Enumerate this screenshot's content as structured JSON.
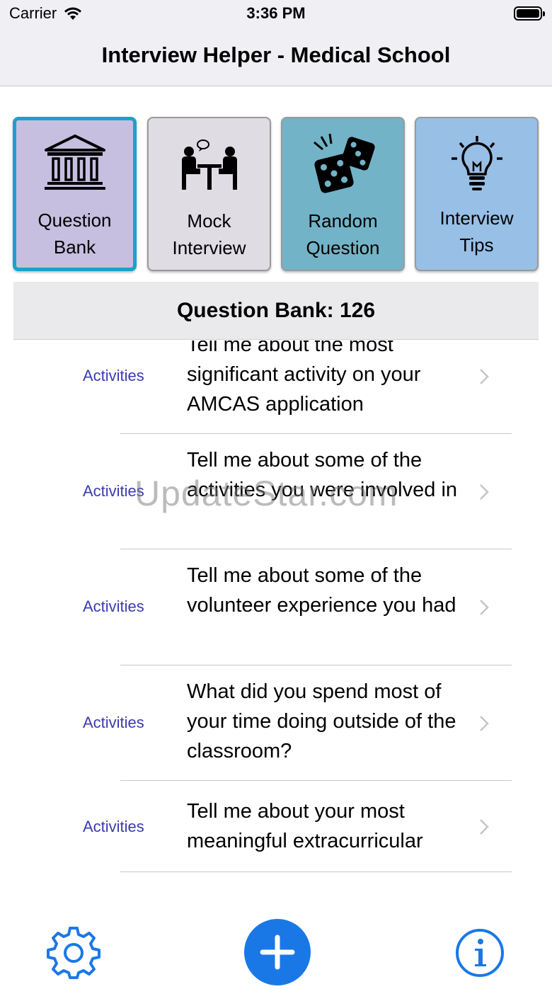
{
  "status": {
    "carrier": "Carrier",
    "time": "3:36 PM"
  },
  "nav": {
    "title": "Interview Helper - Medical School"
  },
  "tiles": [
    {
      "label_line1": "Question",
      "label_line2": "Bank",
      "icon": "bank-building-icon"
    },
    {
      "label_line1": "Mock",
      "label_line2": "Interview",
      "icon": "interview-people-icon"
    },
    {
      "label_line1": "Random",
      "label_line2": "Question",
      "icon": "dice-icon"
    },
    {
      "label_line1": "Interview",
      "label_line2": "Tips",
      "icon": "lightbulb-icon"
    }
  ],
  "section": {
    "title": "Question Bank: 126"
  },
  "questions": [
    {
      "category": "Activities",
      "text": "Tell me about the most significant activity on your AMCAS application"
    },
    {
      "category": "Activities",
      "text": "Tell me about some of the activities you were involved in"
    },
    {
      "category": "Activities",
      "text": "Tell me about some of the volunteer experience you had"
    },
    {
      "category": "Activities",
      "text": "What did you spend most of your time doing outside of the classroom?"
    },
    {
      "category": "Activities",
      "text": "Tell me about your most meaningful extracurricular"
    }
  ],
  "watermark": "UpdateStar.com",
  "toolbar": {
    "settings_icon": "gear-icon",
    "add_icon": "plus-icon",
    "info_icon": "info-icon"
  },
  "colors": {
    "accent": "#1a78e6",
    "category_text": "#3a3ab4",
    "selected_border": "#1aa2c8"
  }
}
